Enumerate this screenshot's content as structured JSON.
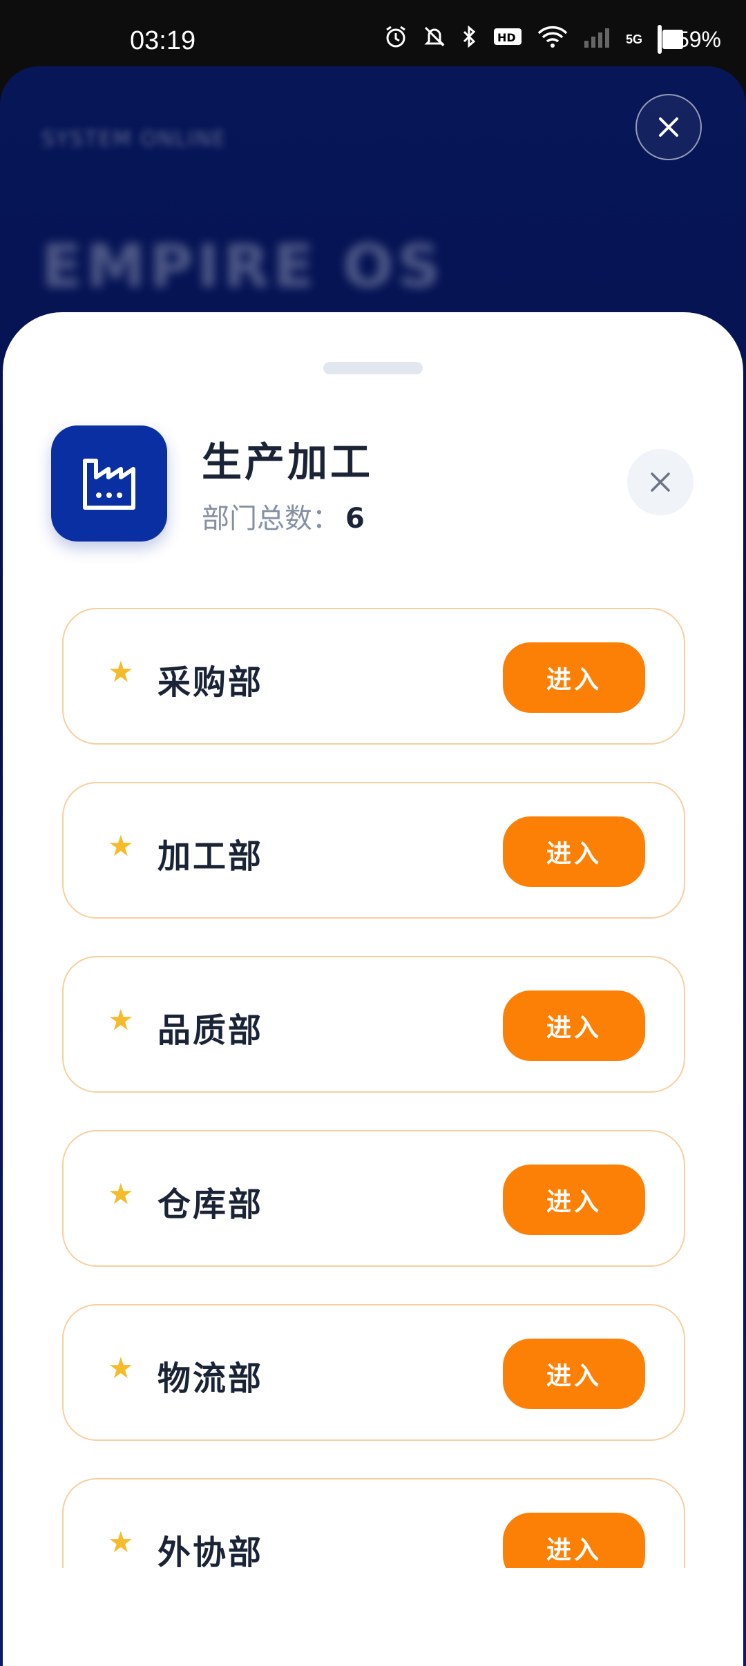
{
  "status_bar": {
    "time": "03:19",
    "battery": "59%",
    "network": "5G",
    "icons": [
      "alarm-icon",
      "mute-icon",
      "bluetooth-icon",
      "hd-icon",
      "wifi-icon",
      "signal-icon",
      "battery-icon"
    ]
  },
  "background_app": {
    "subtitle": "SYSTEM ONLINE",
    "title": "EMPIRE OS"
  },
  "sheet": {
    "title": "生产加工",
    "count_label": "部门总数：",
    "count_value": "6",
    "icon": "factory-icon",
    "accent_color": "#0a2fa3",
    "button_color": "#fd8006",
    "departments": [
      {
        "name": "采购部",
        "action": "进入"
      },
      {
        "name": "加工部",
        "action": "进入"
      },
      {
        "name": "品质部",
        "action": "进入"
      },
      {
        "name": "仓库部",
        "action": "进入"
      },
      {
        "name": "物流部",
        "action": "进入"
      },
      {
        "name": "外协部",
        "action": "进入"
      }
    ]
  }
}
